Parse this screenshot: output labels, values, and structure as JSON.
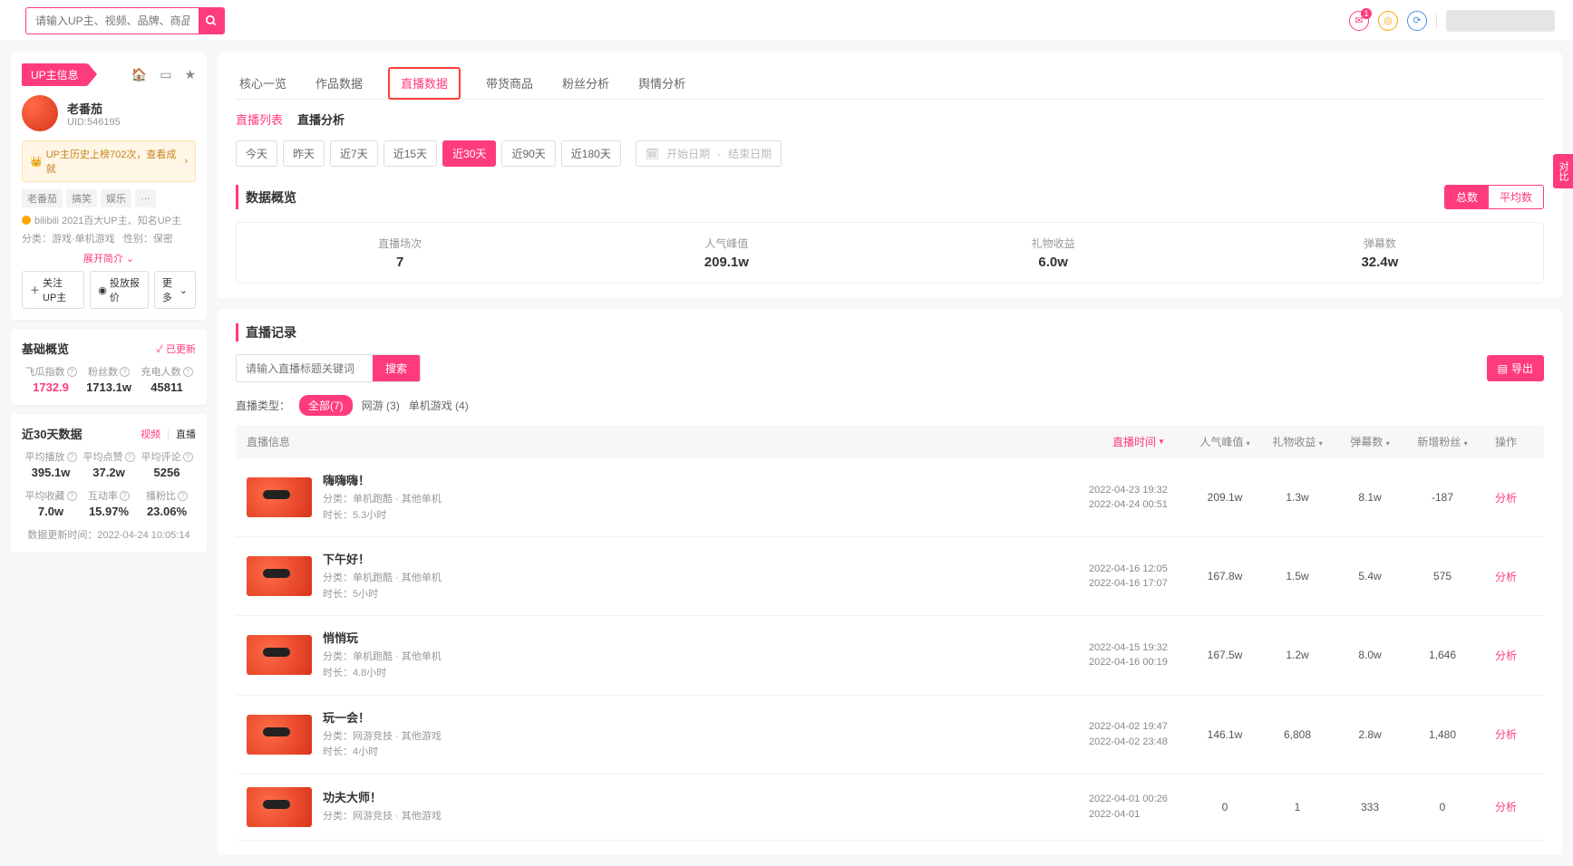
{
  "search": {
    "placeholder": "请输入UP主、视频、品牌、商品关键词搜索"
  },
  "header": {
    "badge": "1"
  },
  "sidebar": {
    "tab_label": "UP主信息",
    "name": "老番茄",
    "uid_label": "UID:546195",
    "rank_text": "UP主历史上榜702次，查看成就",
    "tags": [
      "老番茄",
      "搞笑",
      "娱乐",
      "…"
    ],
    "cert_line1": "bilibili 2021百大UP主、知名UP主",
    "cert_line2_a": "分类：游戏·单机游戏",
    "cert_line2_b": "性别：保密",
    "expand": "展开简介",
    "btn_follow": "关注UP主",
    "btn_quote": "投放报价",
    "btn_more": "更多",
    "basic_title": "基础概览",
    "updated": "已更新",
    "basic_stats": [
      {
        "label": "飞瓜指数",
        "value": "1732.9",
        "pink": true
      },
      {
        "label": "粉丝数",
        "value": "1713.1w"
      },
      {
        "label": "充电人数",
        "value": "45811"
      }
    ],
    "recent_title": "近30天数据",
    "subtab_video": "视频",
    "subtab_live": "直播",
    "recent_stats": [
      {
        "label": "平均播放",
        "value": "395.1w"
      },
      {
        "label": "平均点赞",
        "value": "37.2w"
      },
      {
        "label": "平均评论",
        "value": "5256"
      },
      {
        "label": "平均收藏",
        "value": "7.0w"
      },
      {
        "label": "互动率",
        "value": "15.97%"
      },
      {
        "label": "播粉比",
        "value": "23.06%"
      }
    ],
    "update_time_label": "数据更新时间：",
    "update_time": "2022-04-24 10:05:14"
  },
  "main_tabs": [
    "核心一览",
    "作品数据",
    "直播数据",
    "带货商品",
    "粉丝分析",
    "舆情分析"
  ],
  "sub_nav": {
    "list": "直播列表",
    "analysis": "直播分析"
  },
  "ranges": [
    "今天",
    "昨天",
    "近7天",
    "近15天",
    "近30天",
    "近90天",
    "近180天"
  ],
  "date_picker": {
    "start": "开始日期",
    "sep": "-",
    "end": "结束日期"
  },
  "overview": {
    "title": "数据概览",
    "toggle_total": "总数",
    "toggle_avg": "平均数",
    "items": [
      {
        "label": "直播场次",
        "value": "7"
      },
      {
        "label": "人气峰值",
        "value": "209.1w"
      },
      {
        "label": "礼物收益",
        "value": "6.0w"
      },
      {
        "label": "弹幕数",
        "value": "32.4w"
      }
    ]
  },
  "records": {
    "title": "直播记录",
    "search_placeholder": "请输入直播标题关键词",
    "search_btn": "搜索",
    "export": "导出",
    "type_label": "直播类型：",
    "type_all": "全部(7)",
    "type_opts": [
      "网游 (3)",
      "单机游戏 (4)"
    ],
    "headers": {
      "info": "直播信息",
      "time": "直播时间",
      "peak": "人气峰值",
      "gift": "礼物收益",
      "danmu": "弹幕数",
      "fans": "新增粉丝",
      "action": "操作"
    },
    "rows": [
      {
        "title": "嗨嗨嗨！",
        "cat": "分类：单机跑酷 · 其他单机",
        "dur": "时长：5.3小时",
        "start": "2022-04-23 19:32",
        "end": "2022-04-24 00:51",
        "peak": "209.1w",
        "gift": "1.3w",
        "danmu": "8.1w",
        "fans": "-187",
        "action": "分析"
      },
      {
        "title": "下午好！",
        "cat": "分类：单机跑酷 · 其他单机",
        "dur": "时长：5小时",
        "start": "2022-04-16 12:05",
        "end": "2022-04-16 17:07",
        "peak": "167.8w",
        "gift": "1.5w",
        "danmu": "5.4w",
        "fans": "575",
        "action": "分析"
      },
      {
        "title": "悄悄玩",
        "cat": "分类：单机跑酷 · 其他单机",
        "dur": "时长：4.8小时",
        "start": "2022-04-15 19:32",
        "end": "2022-04-16 00:19",
        "peak": "167.5w",
        "gift": "1.2w",
        "danmu": "8.0w",
        "fans": "1,646",
        "action": "分析"
      },
      {
        "title": "玩一会！",
        "cat": "分类：网游竞技 · 其他游戏",
        "dur": "时长：4小时",
        "start": "2022-04-02 19:47",
        "end": "2022-04-02 23:48",
        "peak": "146.1w",
        "gift": "6,808",
        "danmu": "2.8w",
        "fans": "1,480",
        "action": "分析"
      },
      {
        "title": "功夫大师！",
        "cat": "分类：网游竞技 · 其他游戏",
        "dur": "",
        "start": "2022-04-01 00:26",
        "end": "2022-04-01",
        "peak": "0",
        "gift": "1",
        "danmu": "333",
        "fans": "0",
        "action": "分析"
      }
    ]
  },
  "floating": "对比"
}
